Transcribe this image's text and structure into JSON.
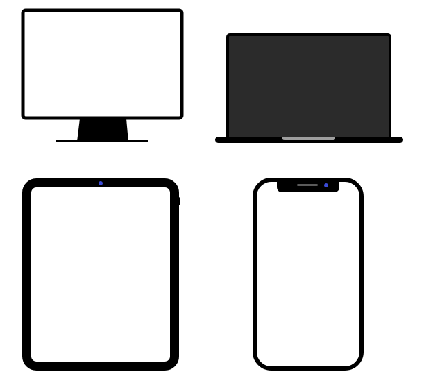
{
  "devices": [
    {
      "kind": "desktop-monitor",
      "screen_color": "#ffffff",
      "frame_color": "#000000"
    },
    {
      "kind": "laptop",
      "screen_color": "#2b2b2b",
      "frame_color": "#000000",
      "hinge_color": "#9e9e9e"
    },
    {
      "kind": "tablet",
      "screen_color": "#ffffff",
      "frame_color": "#000000",
      "camera_color": "#3b4bd6"
    },
    {
      "kind": "smartphone",
      "screen_color": "#ffffff",
      "frame_color": "#000000",
      "camera_color": "#3b4bd6",
      "speaker_color": "#5a5a5a"
    }
  ]
}
